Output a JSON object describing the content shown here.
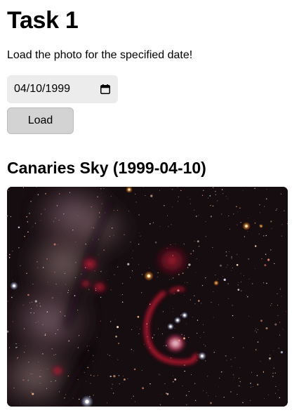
{
  "page": {
    "title": "Task 1",
    "instructions": "Load the photo for the specified date!"
  },
  "date_input": {
    "value": "04/10/1999",
    "icon": "calendar-icon"
  },
  "load_button": {
    "label": "Load"
  },
  "photo": {
    "heading": "Canaries Sky (1999-04-10)",
    "alt": "Canaries Sky",
    "description_kind": "night-sky astrophotograph"
  }
}
